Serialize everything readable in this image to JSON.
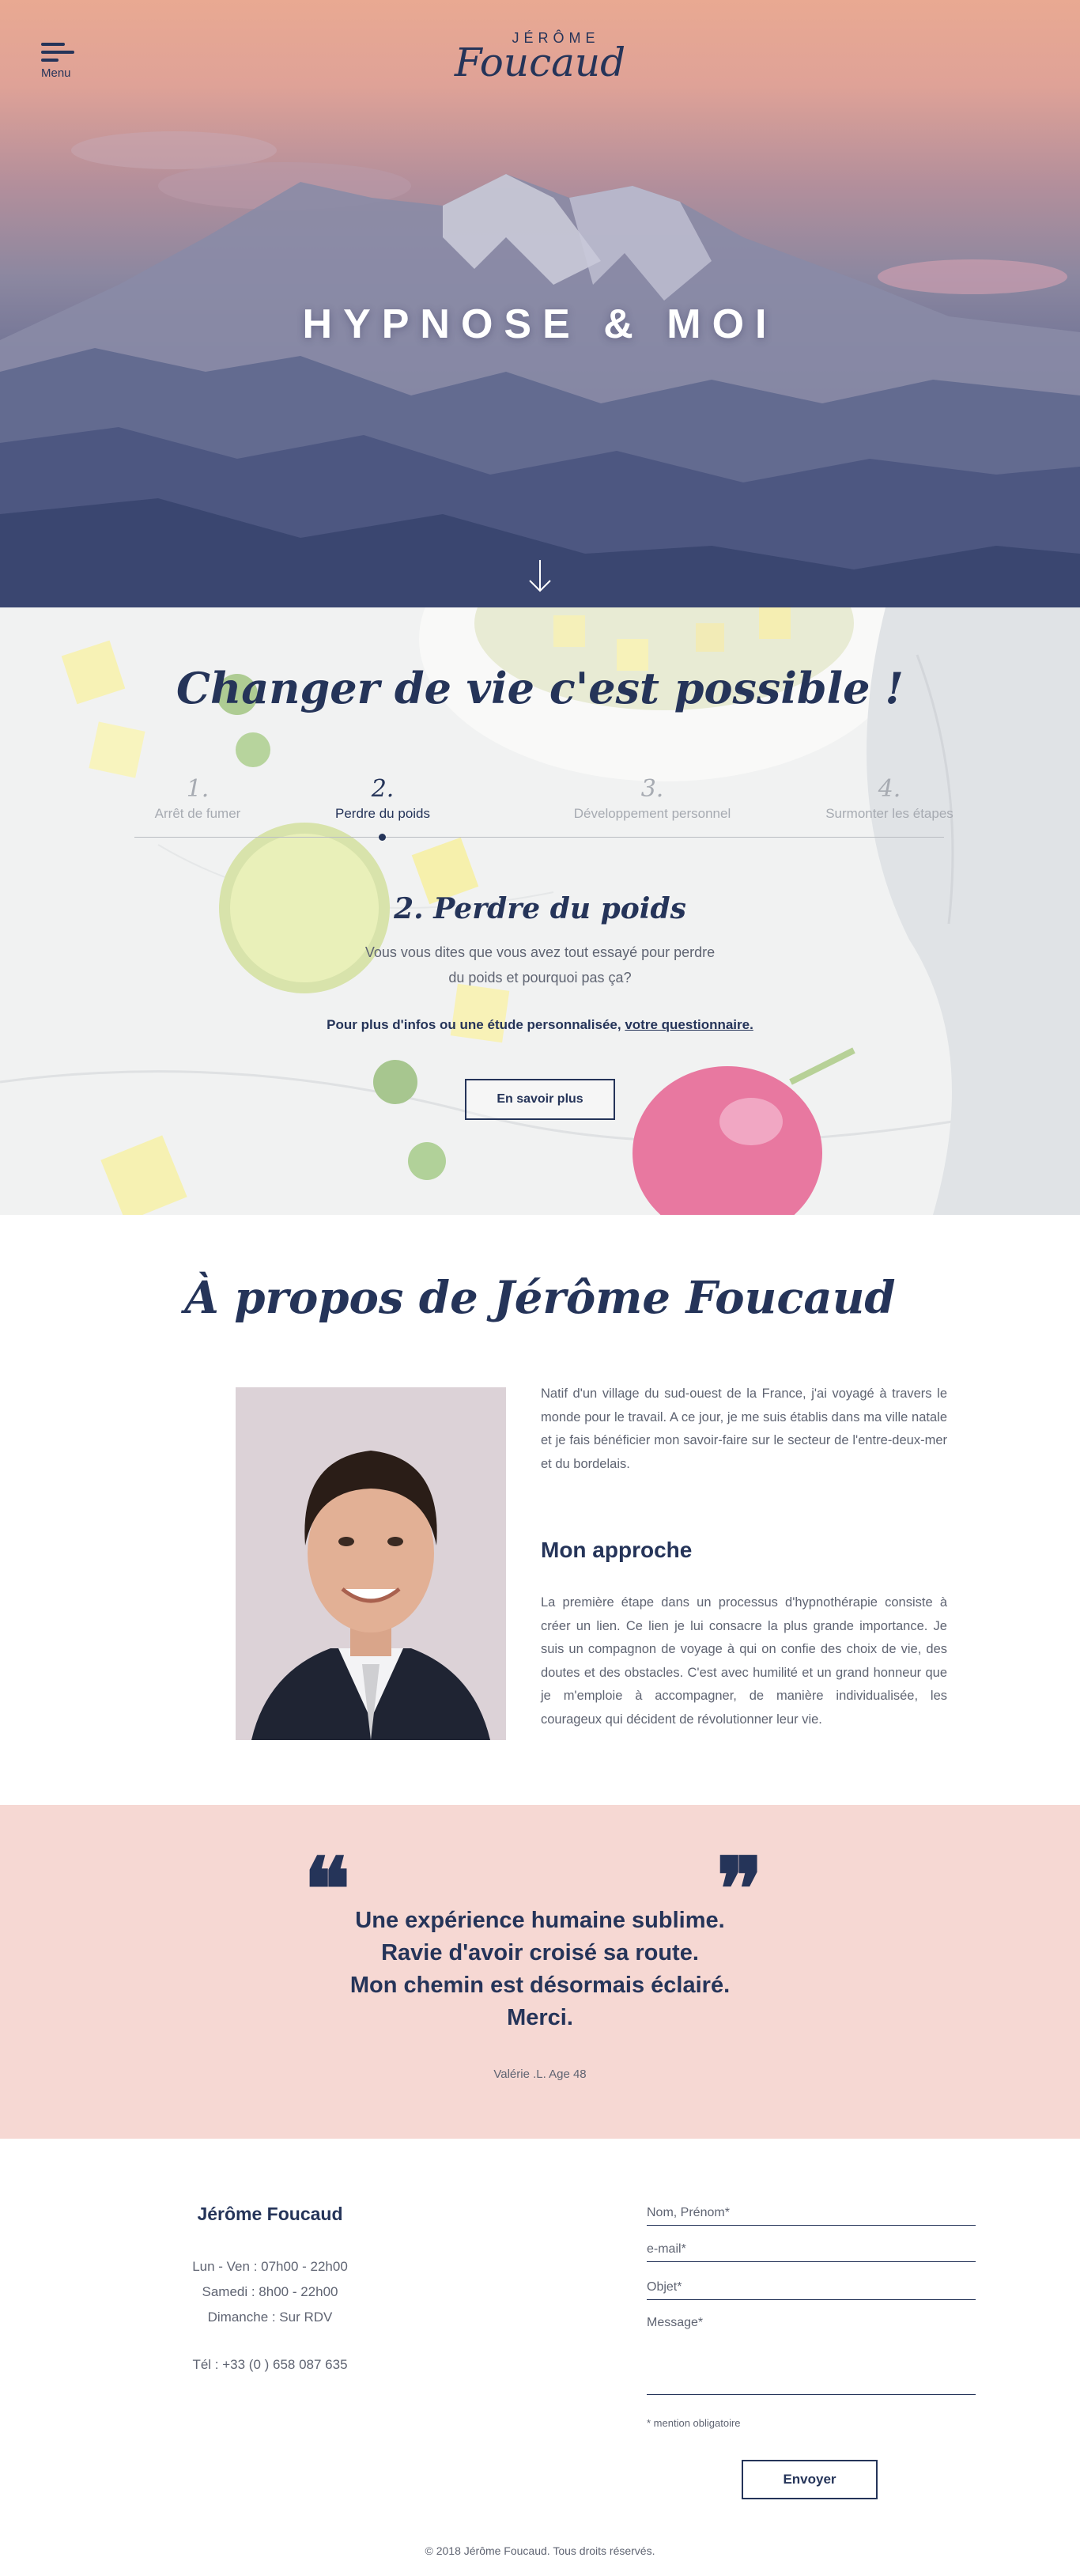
{
  "header": {
    "menu_label": "Menu",
    "logo_top": "JÉRÔME",
    "logo_name": "Foucaud"
  },
  "hero": {
    "title": "HYPNOSE & MOI"
  },
  "steps": {
    "title": "Changer de vie c'est possible !",
    "tabs": [
      {
        "num": "1.",
        "label": "Arrêt de fumer"
      },
      {
        "num": "2.",
        "label": "Perdre du poids"
      },
      {
        "num": "3.",
        "label": "Développement personnel"
      },
      {
        "num": "4.",
        "label": "Surmonter les étapes"
      }
    ],
    "active_index": 1,
    "subtitle": "2. Perdre du poids",
    "text_line1": "Vous vous dites que vous avez tout essayé pour perdre",
    "text_line2": "du poids et pourquoi pas ça?",
    "info_prefix": "Pour plus d'infos ou une étude personnalisée,",
    "info_link": "votre questionnaire.",
    "button": "En savoir plus"
  },
  "about": {
    "title": "À propos de Jérôme Foucaud",
    "text": "Natif d'un village du sud-ouest de la France, j'ai voyagé à travers le monde pour le travail. A ce jour, je me suis établis dans ma ville natale et je fais bénéficier mon savoir-faire sur le secteur de l'entre-deux-mer et du bordelais.",
    "approach_title": "Mon approche",
    "approach_text": "La première étape dans un processus d'hypnothérapie consiste à créer un lien. Ce lien je lui consacre la plus grande importance. Je suis un compagnon de voyage à qui on confie des choix de vie, des doutes et des obstacles. C'est avec humilité et un grand honneur que je m'emploie à accompagner, de manière individualisée, les courageux qui décident de révolutionner leur vie."
  },
  "testimonial": {
    "open_quote": "❝",
    "close_quote": "❞",
    "lines": [
      "Une expérience humaine sublime.",
      "Ravie d'avoir croisé sa route.",
      "Mon chemin est désormais éclairé.",
      "Merci."
    ],
    "author": "Valérie .L. Age 48"
  },
  "contact": {
    "name": "Jérôme Foucaud",
    "hours": [
      "Lun - Ven : 07h00 - 22h00",
      "Samedi : 8h00 - 22h00",
      "Dimanche : Sur RDV"
    ],
    "phone": "Tél : +33 (0 ) 658 087 635",
    "form": {
      "name_placeholder": "Nom, Prénom*",
      "email_placeholder": "e-mail*",
      "subject_placeholder": "Objet*",
      "message_placeholder": "Message*",
      "mention": "* mention obligatoire",
      "submit": "Envoyer"
    },
    "copyright": "© 2018 Jérôme Foucaud. Tous droits réservés."
  },
  "colors": {
    "navy": "#253459",
    "pink_band": "#f6d8d3",
    "text_gray": "#5f6472"
  }
}
